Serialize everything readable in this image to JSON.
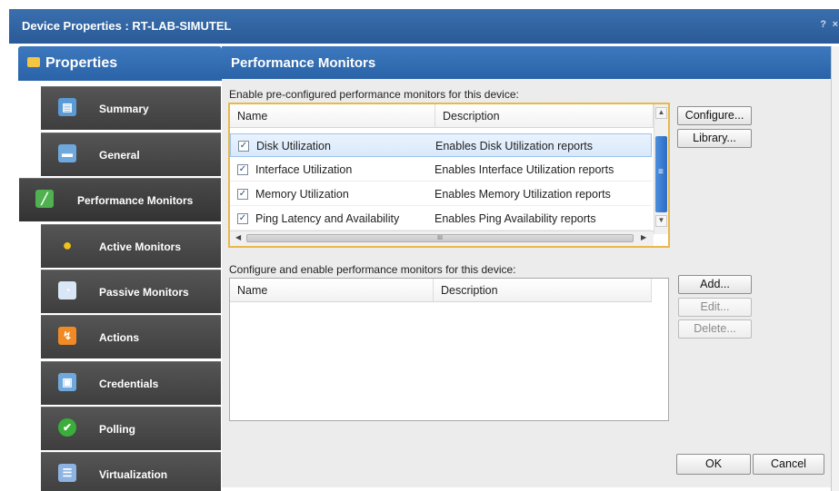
{
  "window": {
    "title": "Device Properties : RT-LAB-SIMUTEL",
    "help_label": "?",
    "close_label": "×"
  },
  "sidebar": {
    "header": "Properties",
    "items": [
      {
        "label": "Summary",
        "icon": "summary-icon",
        "color": "#5b9bd5"
      },
      {
        "label": "General",
        "icon": "computer-icon",
        "color": "#6fa8dc"
      },
      {
        "label": "Performance Monitors",
        "icon": "chart-icon",
        "color": "#4fb14f",
        "active": true
      },
      {
        "label": "Active Monitors",
        "icon": "lightbulb-icon",
        "color": "#f2c21b"
      },
      {
        "label": "Passive Monitors",
        "icon": "gauge-icon",
        "color": "#d9e6f5"
      },
      {
        "label": "Actions",
        "icon": "lightning-icon",
        "color": "#f08a24"
      },
      {
        "label": "Credentials",
        "icon": "id-card-icon",
        "color": "#6fa8dc"
      },
      {
        "label": "Polling",
        "icon": "checkmark-icon",
        "color": "#3aae3a"
      },
      {
        "label": "Virtualization",
        "icon": "stack-icon",
        "color": "#8db3e2"
      }
    ]
  },
  "panel": {
    "title": "Performance Monitors",
    "preconfigured": {
      "label": "Enable pre-configured performance monitors for this device:",
      "columns": {
        "name": "Name",
        "description": "Description"
      },
      "rows": [
        {
          "checked": true,
          "name": "Disk Utilization",
          "description": "Enables Disk Utilization reports",
          "selected": true
        },
        {
          "checked": true,
          "name": "Interface Utilization",
          "description": "Enables Interface Utilization reports"
        },
        {
          "checked": true,
          "name": "Memory Utilization",
          "description": "Enables Memory Utilization reports"
        },
        {
          "checked": true,
          "name": "Ping Latency and Availability",
          "description": "Enables Ping Availability reports"
        }
      ],
      "scroll_grip": "III",
      "vscroll_grip": "≡",
      "buttons": {
        "configure": "Configure...",
        "library": "Library..."
      }
    },
    "custom": {
      "label": "Configure and enable performance monitors for this device:",
      "columns": {
        "name": "Name",
        "description": "Description"
      },
      "buttons": {
        "add": "Add...",
        "edit": "Edit...",
        "delete": "Delete..."
      }
    },
    "footer": {
      "ok": "OK",
      "cancel": "Cancel"
    }
  }
}
